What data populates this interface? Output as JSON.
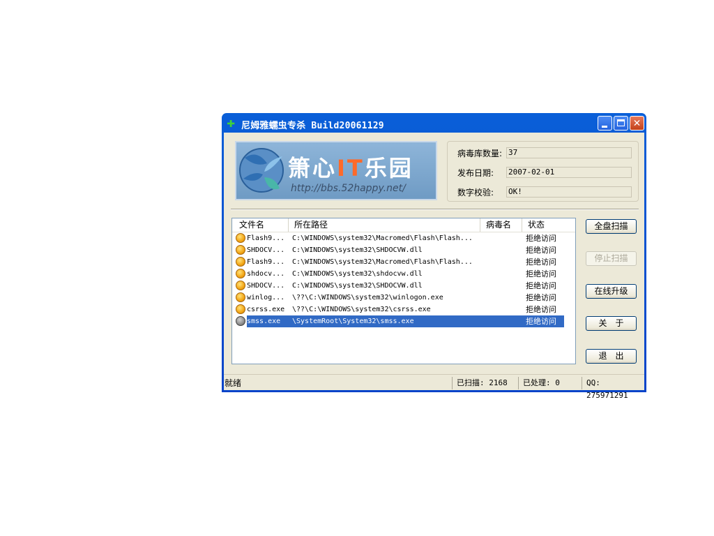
{
  "window": {
    "title": "尼姆雅蠕虫专杀 Build20061129"
  },
  "banner": {
    "title_part1": "箫心",
    "title_part2": "IT",
    "title_part3": "乐园",
    "url": "http://bbs.52happy.net/"
  },
  "info": {
    "rows": [
      {
        "label": "病毒库数量:",
        "value": "37"
      },
      {
        "label": "发布日期:",
        "value": "2007-02-01"
      },
      {
        "label": "数字校验:",
        "value": "OK!"
      }
    ]
  },
  "list": {
    "columns": [
      "文件名",
      "所在路径",
      "病毒名",
      "状态"
    ],
    "rows": [
      {
        "name": "Flash9...",
        "path": "C:\\WINDOWS\\system32\\Macromed\\Flash\\Flash...",
        "virus": "",
        "status": "拒绝访问"
      },
      {
        "name": "SHDOCV...",
        "path": "C:\\WINDOWS\\system32\\SHDOCVW.dll",
        "virus": "",
        "status": "拒绝访问"
      },
      {
        "name": "Flash9...",
        "path": "C:\\WINDOWS\\system32\\Macromed\\Flash\\Flash...",
        "virus": "",
        "status": "拒绝访问"
      },
      {
        "name": "shdocv...",
        "path": "C:\\WINDOWS\\system32\\shdocvw.dll",
        "virus": "",
        "status": "拒绝访问"
      },
      {
        "name": "SHDOCV...",
        "path": "C:\\WINDOWS\\system32\\SHDOCVW.dll",
        "virus": "",
        "status": "拒绝访问"
      },
      {
        "name": "winlog...",
        "path": "\\??\\C:\\WINDOWS\\system32\\winlogon.exe",
        "virus": "",
        "status": "拒绝访问"
      },
      {
        "name": "csrss.exe",
        "path": "\\??\\C:\\WINDOWS\\system32\\csrss.exe",
        "virus": "",
        "status": "拒绝访问"
      },
      {
        "name": "smss.exe",
        "path": "\\SystemRoot\\System32\\smss.exe",
        "virus": "",
        "status": "拒绝访问",
        "selected": true
      }
    ]
  },
  "buttons": {
    "full_scan": "全盘扫描",
    "stop_scan": "停止扫描",
    "online_update": "在线升级",
    "about": "关　于",
    "exit": "退　出"
  },
  "statusbar": {
    "status": "就绪",
    "scanned": "已扫描: 2168",
    "processed": "已处理: 0",
    "qq": "QQ: 275971291"
  },
  "colors": {
    "title_bar": "#0a5fd8",
    "selection": "#316ac5",
    "client_bg": "#ece9d8"
  },
  "icons": {
    "app": "green-plus-icon",
    "file": "orange-ball-icon"
  }
}
